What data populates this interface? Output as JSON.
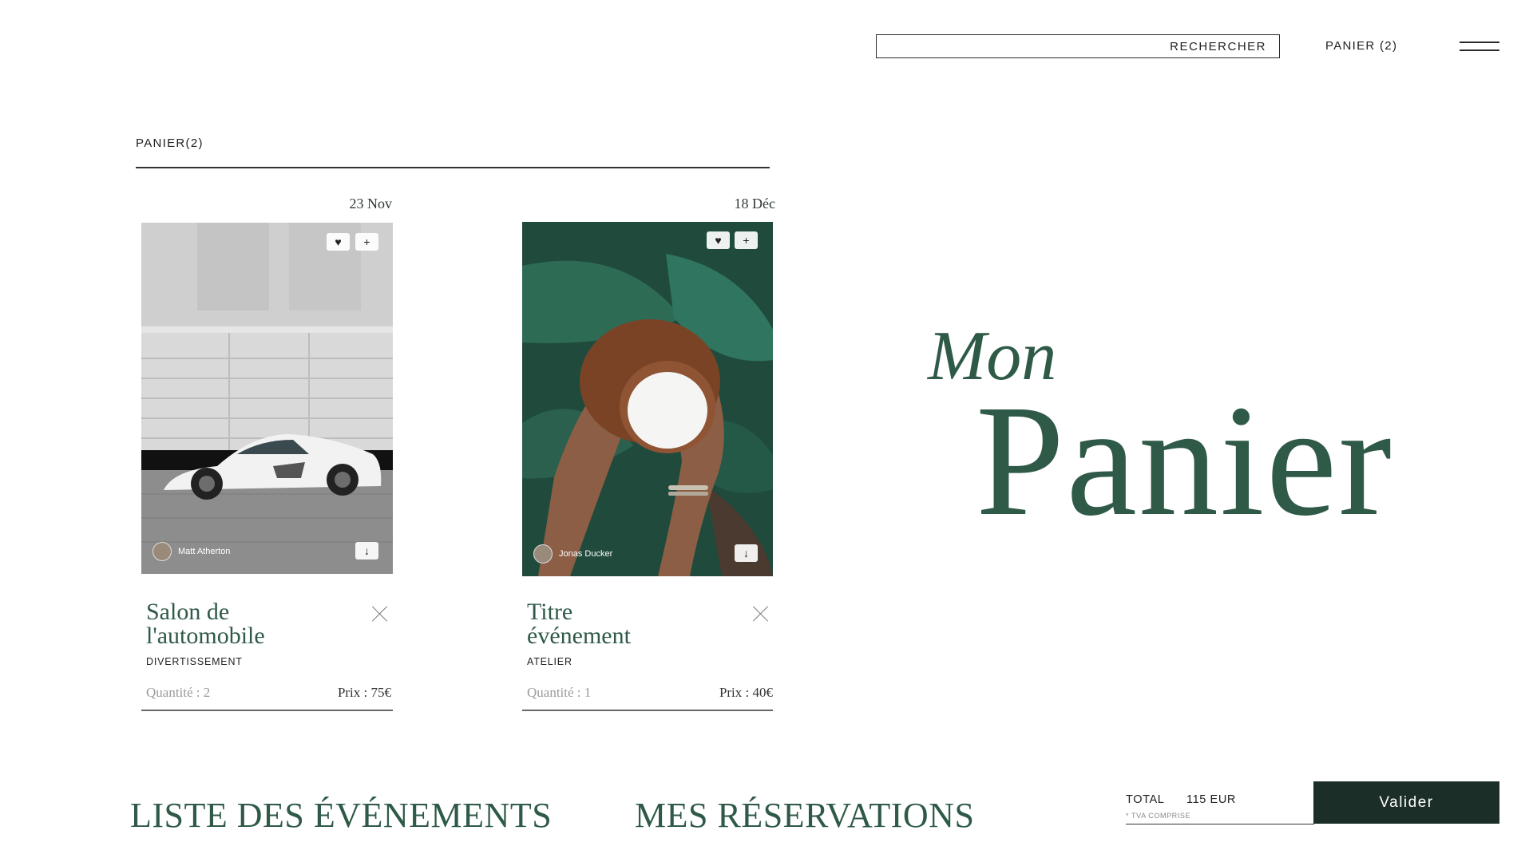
{
  "header": {
    "search_label": "RECHERCHER",
    "cart_link": "PANIER (2)",
    "menu_icon": "hamburger-icon"
  },
  "cart": {
    "heading": "PANIER(2)"
  },
  "items": [
    {
      "date": "23 Nov",
      "photo_credit": "Matt Atherton",
      "title_line1": "Salon de",
      "title_line2": "l'automobile",
      "category": "DIVERTISSEMENT",
      "quantity": "Quantité : 2",
      "price": "Prix : 75€"
    },
    {
      "date": "18 Déc",
      "photo_credit": "Jonas Ducker",
      "title_line1": "Titre",
      "title_line2": "événement",
      "category": "ATELIER",
      "quantity": "Quantité : 1",
      "price": "Prix : 40€"
    }
  ],
  "hero": {
    "word1": "Mon",
    "word2": "Panier"
  },
  "footer": {
    "nav_events": "LISTE DES ÉVÉNEMENTS",
    "nav_reservations": "MES RÉSERVATIONS",
    "total_label": "TOTAL",
    "total_value": "115 EUR",
    "tva_note": "* TVA COMPRISE",
    "validate_label": "Valider"
  },
  "colors": {
    "accent_green": "#2f5a47",
    "button_dark": "#1c2e28"
  }
}
